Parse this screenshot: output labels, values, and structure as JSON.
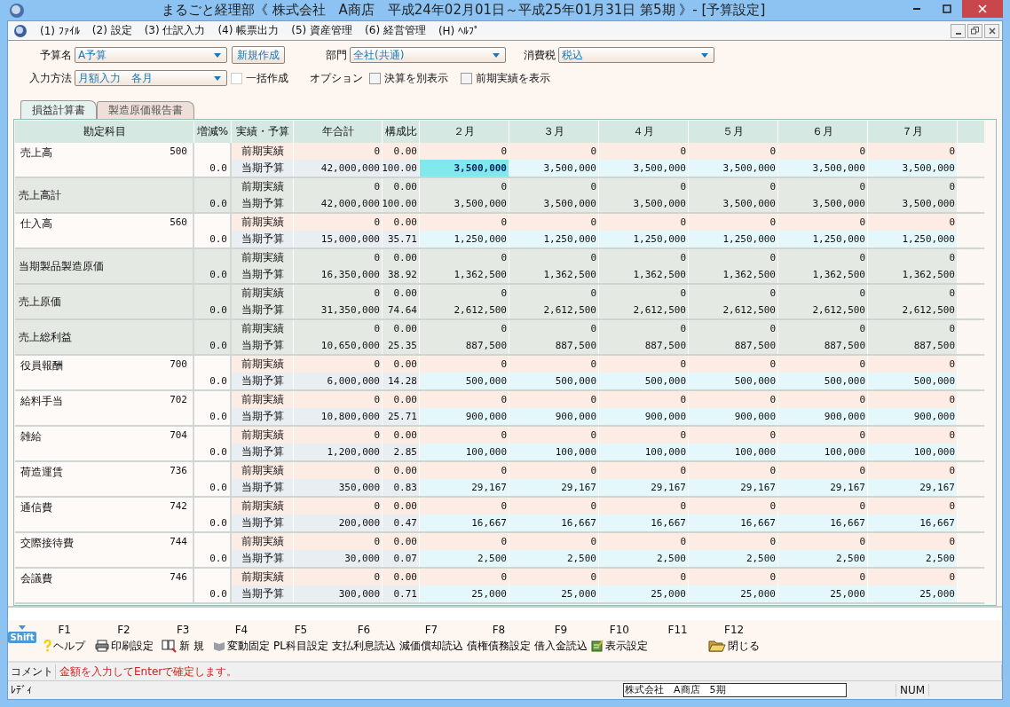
{
  "window": {
    "title": "まるごと経理部《 株式会社　A商店　平成24年02月01日～平成25年01月31日 第5期 》- [予算設定]"
  },
  "menu": [
    "(1) ﾌｧｲﾙ",
    "(2) 設定",
    "(3) 仕訳入力",
    "(4) 帳票出力",
    "(5) 資産管理",
    "(6) 経営管理",
    "(H) ﾍﾙﾌﾟ"
  ],
  "form": {
    "budget_name": {
      "label": "予算名",
      "value": "A予算"
    },
    "new_button": "新規作成",
    "department": {
      "label": "部門",
      "value": "全社(共通)"
    },
    "tax": {
      "label": "消費税",
      "value": "税込"
    },
    "input_method": {
      "label": "入力方法",
      "value": "月額入力　各月"
    },
    "options": [
      {
        "label": "一括作成",
        "checked": false,
        "disabled": true
      },
      {
        "label": "決算を別表示",
        "checked": false,
        "disabled": false
      },
      {
        "label": "前期実績を表示",
        "checked": false,
        "disabled": false
      }
    ],
    "options_label": "オプション"
  },
  "tabs": [
    {
      "label": "損益計算書",
      "selected": true
    },
    {
      "label": "製造原価報告書",
      "selected": false
    }
  ],
  "table": {
    "columns": [
      "勘定科目",
      "増減%",
      "実績・予算",
      "年合計",
      "構成比",
      "２月",
      "３月",
      "４月",
      "５月",
      "６月",
      "７月"
    ],
    "rows": [
      {
        "kind": "account",
        "name": "売上高",
        "code": "500",
        "change": "0.0",
        "prev": {
          "label": "前期実績",
          "total": "0",
          "ratio": "0.00",
          "months": [
            "0",
            "0",
            "0",
            "0",
            "0",
            "0"
          ]
        },
        "budget": {
          "label": "当期予算",
          "total": "42,000,000",
          "ratio": "100.00",
          "months": [
            {
              "value": "3,500,000",
              "selected": true
            },
            {
              "value": "3,500,000",
              "selected": false
            },
            {
              "value": "3,500,000",
              "selected": false
            },
            {
              "value": "3,500,000",
              "selected": false
            },
            {
              "value": "3,500,000",
              "selected": false
            },
            {
              "value": "3,500,000",
              "selected": false
            }
          ]
        }
      },
      {
        "kind": "total",
        "name": "売上高計",
        "change": "0.0",
        "prev": {
          "label": "前期実績",
          "total": "0",
          "ratio": "0.00",
          "months": [
            "0",
            "0",
            "0",
            "0",
            "0",
            "0"
          ]
        },
        "budget": {
          "label": "当期予算",
          "total": "42,000,000",
          "ratio": "100.00",
          "months": [
            {
              "value": "3,500,000",
              "selected": false
            },
            {
              "value": "3,500,000",
              "selected": false
            },
            {
              "value": "3,500,000",
              "selected": false
            },
            {
              "value": "3,500,000",
              "selected": false
            },
            {
              "value": "3,500,000",
              "selected": false
            },
            {
              "value": "3,500,000",
              "selected": false
            }
          ]
        }
      },
      {
        "kind": "account",
        "name": "仕入高",
        "code": "560",
        "change": "0.0",
        "prev": {
          "label": "前期実績",
          "total": "0",
          "ratio": "0.00",
          "months": [
            "0",
            "0",
            "0",
            "0",
            "0",
            "0"
          ]
        },
        "budget": {
          "label": "当期予算",
          "total": "15,000,000",
          "ratio": "35.71",
          "months": [
            {
              "value": "1,250,000",
              "selected": false
            },
            {
              "value": "1,250,000",
              "selected": false
            },
            {
              "value": "1,250,000",
              "selected": false
            },
            {
              "value": "1,250,000",
              "selected": false
            },
            {
              "value": "1,250,000",
              "selected": false
            },
            {
              "value": "1,250,000",
              "selected": false
            }
          ]
        }
      },
      {
        "kind": "total",
        "name": "当期製品製造原価",
        "change": "0.0",
        "prev": {
          "label": "前期実績",
          "total": "0",
          "ratio": "0.00",
          "months": [
            "0",
            "0",
            "0",
            "0",
            "0",
            "0"
          ]
        },
        "budget": {
          "label": "当期予算",
          "total": "16,350,000",
          "ratio": "38.92",
          "months": [
            {
              "value": "1,362,500",
              "selected": false
            },
            {
              "value": "1,362,500",
              "selected": false
            },
            {
              "value": "1,362,500",
              "selected": false
            },
            {
              "value": "1,362,500",
              "selected": false
            },
            {
              "value": "1,362,500",
              "selected": false
            },
            {
              "value": "1,362,500",
              "selected": false
            }
          ]
        }
      },
      {
        "kind": "total",
        "name": "売上原価",
        "change": "0.0",
        "prev": {
          "label": "前期実績",
          "total": "0",
          "ratio": "0.00",
          "months": [
            "0",
            "0",
            "0",
            "0",
            "0",
            "0"
          ]
        },
        "budget": {
          "label": "当期予算",
          "total": "31,350,000",
          "ratio": "74.64",
          "months": [
            {
              "value": "2,612,500",
              "selected": false
            },
            {
              "value": "2,612,500",
              "selected": false
            },
            {
              "value": "2,612,500",
              "selected": false
            },
            {
              "value": "2,612,500",
              "selected": false
            },
            {
              "value": "2,612,500",
              "selected": false
            },
            {
              "value": "2,612,500",
              "selected": false
            }
          ]
        }
      },
      {
        "kind": "total",
        "name": "売上総利益",
        "change": "0.0",
        "prev": {
          "label": "前期実績",
          "total": "0",
          "ratio": "0.00",
          "months": [
            "0",
            "0",
            "0",
            "0",
            "0",
            "0"
          ]
        },
        "budget": {
          "label": "当期予算",
          "total": "10,650,000",
          "ratio": "25.35",
          "months": [
            {
              "value": "887,500",
              "selected": false
            },
            {
              "value": "887,500",
              "selected": false
            },
            {
              "value": "887,500",
              "selected": false
            },
            {
              "value": "887,500",
              "selected": false
            },
            {
              "value": "887,500",
              "selected": false
            },
            {
              "value": "887,500",
              "selected": false
            }
          ]
        }
      },
      {
        "kind": "account",
        "name": "役員報酬",
        "code": "700",
        "change": "0.0",
        "prev": {
          "label": "前期実績",
          "total": "0",
          "ratio": "0.00",
          "months": [
            "0",
            "0",
            "0",
            "0",
            "0",
            "0"
          ]
        },
        "budget": {
          "label": "当期予算",
          "total": "6,000,000",
          "ratio": "14.28",
          "months": [
            {
              "value": "500,000",
              "selected": false
            },
            {
              "value": "500,000",
              "selected": false
            },
            {
              "value": "500,000",
              "selected": false
            },
            {
              "value": "500,000",
              "selected": false
            },
            {
              "value": "500,000",
              "selected": false
            },
            {
              "value": "500,000",
              "selected": false
            }
          ]
        }
      },
      {
        "kind": "account",
        "name": "給料手当",
        "code": "702",
        "change": "0.0",
        "prev": {
          "label": "前期実績",
          "total": "0",
          "ratio": "0.00",
          "months": [
            "0",
            "0",
            "0",
            "0",
            "0",
            "0"
          ]
        },
        "budget": {
          "label": "当期予算",
          "total": "10,800,000",
          "ratio": "25.71",
          "months": [
            {
              "value": "900,000",
              "selected": false
            },
            {
              "value": "900,000",
              "selected": false
            },
            {
              "value": "900,000",
              "selected": false
            },
            {
              "value": "900,000",
              "selected": false
            },
            {
              "value": "900,000",
              "selected": false
            },
            {
              "value": "900,000",
              "selected": false
            }
          ]
        }
      },
      {
        "kind": "account",
        "name": "雑給",
        "code": "704",
        "change": "0.0",
        "prev": {
          "label": "前期実績",
          "total": "0",
          "ratio": "0.00",
          "months": [
            "0",
            "0",
            "0",
            "0",
            "0",
            "0"
          ]
        },
        "budget": {
          "label": "当期予算",
          "total": "1,200,000",
          "ratio": "2.85",
          "months": [
            {
              "value": "100,000",
              "selected": false
            },
            {
              "value": "100,000",
              "selected": false
            },
            {
              "value": "100,000",
              "selected": false
            },
            {
              "value": "100,000",
              "selected": false
            },
            {
              "value": "100,000",
              "selected": false
            },
            {
              "value": "100,000",
              "selected": false
            }
          ]
        }
      },
      {
        "kind": "account",
        "name": "荷造運賃",
        "code": "736",
        "change": "0.0",
        "prev": {
          "label": "前期実績",
          "total": "0",
          "ratio": "0.00",
          "months": [
            "0",
            "0",
            "0",
            "0",
            "0",
            "0"
          ]
        },
        "budget": {
          "label": "当期予算",
          "total": "350,000",
          "ratio": "0.83",
          "months": [
            {
              "value": "29,167",
              "selected": false
            },
            {
              "value": "29,167",
              "selected": false
            },
            {
              "value": "29,167",
              "selected": false
            },
            {
              "value": "29,167",
              "selected": false
            },
            {
              "value": "29,167",
              "selected": false
            },
            {
              "value": "29,167",
              "selected": false
            }
          ]
        }
      },
      {
        "kind": "account",
        "name": "通信費",
        "code": "742",
        "change": "0.0",
        "prev": {
          "label": "前期実績",
          "total": "0",
          "ratio": "0.00",
          "months": [
            "0",
            "0",
            "0",
            "0",
            "0",
            "0"
          ]
        },
        "budget": {
          "label": "当期予算",
          "total": "200,000",
          "ratio": "0.47",
          "months": [
            {
              "value": "16,667",
              "selected": false
            },
            {
              "value": "16,667",
              "selected": false
            },
            {
              "value": "16,667",
              "selected": false
            },
            {
              "value": "16,667",
              "selected": false
            },
            {
              "value": "16,667",
              "selected": false
            },
            {
              "value": "16,667",
              "selected": false
            }
          ]
        }
      },
      {
        "kind": "account",
        "name": "交際接待費",
        "code": "744",
        "change": "0.0",
        "prev": {
          "label": "前期実績",
          "total": "0",
          "ratio": "0.00",
          "months": [
            "0",
            "0",
            "0",
            "0",
            "0",
            "0"
          ]
        },
        "budget": {
          "label": "当期予算",
          "total": "30,000",
          "ratio": "0.07",
          "months": [
            {
              "value": "2,500",
              "selected": false
            },
            {
              "value": "2,500",
              "selected": false
            },
            {
              "value": "2,500",
              "selected": false
            },
            {
              "value": "2,500",
              "selected": false
            },
            {
              "value": "2,500",
              "selected": false
            },
            {
              "value": "2,500",
              "selected": false
            }
          ]
        }
      },
      {
        "kind": "account",
        "name": "会議費",
        "code": "746",
        "change": "0.0",
        "prev": {
          "label": "前期実績",
          "total": "0",
          "ratio": "0.00",
          "months": [
            "0",
            "0",
            "0",
            "0",
            "0",
            "0"
          ]
        },
        "budget": {
          "label": "当期予算",
          "total": "300,000",
          "ratio": "0.71",
          "months": [
            {
              "value": "25,000",
              "selected": false
            },
            {
              "value": "25,000",
              "selected": false
            },
            {
              "value": "25,000",
              "selected": false
            },
            {
              "value": "25,000",
              "selected": false
            },
            {
              "value": "25,000",
              "selected": false
            },
            {
              "value": "25,000",
              "selected": false
            }
          ]
        }
      }
    ]
  },
  "function_keys": {
    "shift": "Shift",
    "keys": [
      {
        "key": "F1",
        "label": "ヘルプ",
        "kind": "help"
      },
      {
        "key": "F2",
        "label": "印刷設定",
        "kind": "print"
      },
      {
        "key": "F3",
        "label": "新 規",
        "kind": "search"
      },
      {
        "key": "F4",
        "label": "変動固定",
        "kind": "book"
      },
      {
        "key": "F5",
        "label": "PL科目設定",
        "kind": "text"
      },
      {
        "key": "F6",
        "label": "支払利息読込",
        "kind": "text"
      },
      {
        "key": "F7",
        "label": "減価償却読込",
        "kind": "text"
      },
      {
        "key": "F8",
        "label": "債権債務設定",
        "kind": "text"
      },
      {
        "key": "F9",
        "label": "借入金読込",
        "kind": "text"
      },
      {
        "key": "F10",
        "label": "表示設定",
        "kind": "edit"
      },
      {
        "key": "F11",
        "kind": "text"
      },
      {
        "key": "F12",
        "label": "閉じる",
        "kind": "folder"
      }
    ]
  },
  "comment": {
    "label": "コメント",
    "text": "金額を入力してEnterで確定します。"
  },
  "status_bar": {
    "state": "ﾚﾃﾞｨ",
    "company": "株式会社　A商店　5期",
    "num": "NUM"
  }
}
